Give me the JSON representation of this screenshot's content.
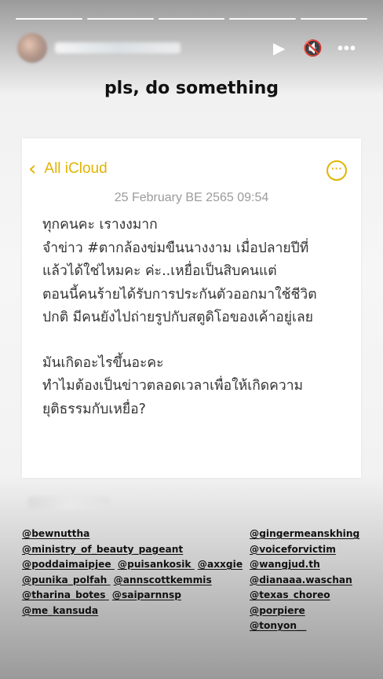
{
  "story": {
    "segments": 5,
    "controls": {
      "play_icon": "▶",
      "mute_icon": "🔇",
      "more_icon": "•••"
    }
  },
  "headline": "pls, do something",
  "note": {
    "back_label": "All iCloud",
    "date": "25 February BE 2565 09:54",
    "lines": [
      "ทุกคนคะ เรางงมาก",
      "จำข่าว #ตากล้องข่มขืนนางงาม เมื่อปลายปีที่",
      "แล้วได้ใช่ไหมคะ ค่ะ..เหยื่อเป็นสิบคนแต่",
      "ตอนนี้คนร้ายได้รับการประกันตัวออกมาใช้ชีวิต",
      "ปกติ มีคนยังไปถ่ายรูปกับสตูดิโอของเค้าอยู่เลย",
      "",
      "มันเกิดอะไรขึ้นอะคะ",
      "ทำไมต้องเป็นข่าวตลอดเวลาเพื่อให้เกิดความ",
      "ยุติธรรมกับเหยื่อ?"
    ],
    "accent_color": "#e2b400"
  },
  "mentions_left": [
    [
      "@bewnuttha"
    ],
    [
      "@ministry_of_beauty_pageant"
    ],
    [
      "@poddaimaipjee",
      "@puisankosik",
      "@axxgie"
    ],
    [
      "@punika_polfah",
      "@annscottkemmis"
    ],
    [
      "@tharina_botes",
      "@saiparnnsp"
    ],
    [
      "@me_kansuda"
    ]
  ],
  "mentions_right": [
    "@gingermeanskhing",
    "@voiceforvictim",
    "@wangjud.th",
    "@dianaaa.waschan",
    "@texas_choreo",
    "@porpiere",
    "@tonyon__"
  ]
}
